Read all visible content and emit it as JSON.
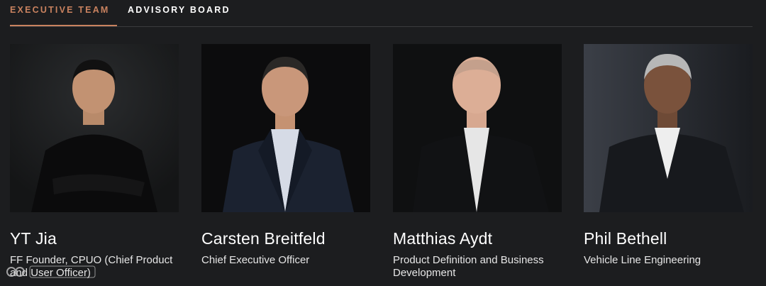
{
  "tabs": [
    {
      "label": "EXECUTIVE TEAM",
      "active": true
    },
    {
      "label": "ADVISORY BOARD",
      "active": false
    }
  ],
  "accent_color": "#c9825f",
  "people": [
    {
      "name": "YT Jia",
      "title": "FF Founder, CPUO (Chief Product and User Officer)"
    },
    {
      "name": "Carsten Breitfeld",
      "title": "Chief Executive Officer"
    },
    {
      "name": "Matthias Aydt",
      "title": "Product Definition and Business Development"
    },
    {
      "name": "Phil Bethell",
      "title": "Vehicle Line Engineering"
    }
  ]
}
